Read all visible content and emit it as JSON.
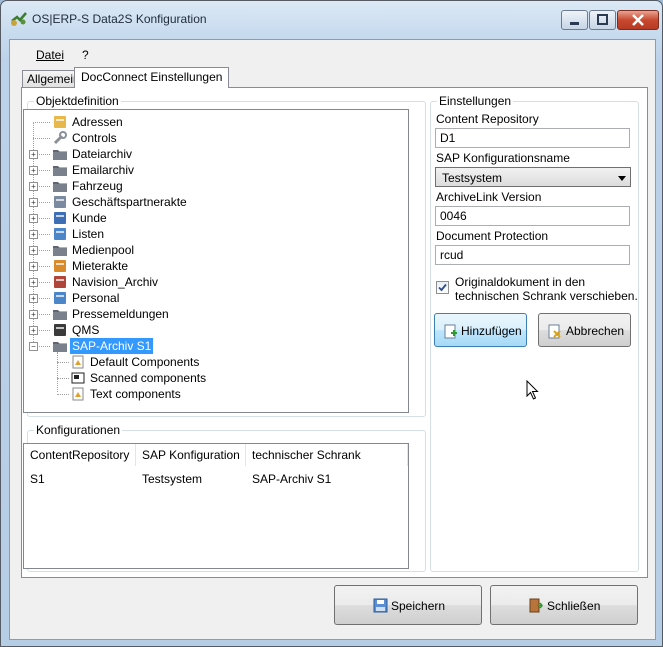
{
  "window": {
    "title": "OS|ERP-S Data2S Konfiguration"
  },
  "menu": {
    "datei": "Datei",
    "help": "?"
  },
  "tabs": [
    {
      "label": "Allgemein"
    },
    {
      "label": "DocConnect Einstellungen"
    }
  ],
  "objektdefinition": {
    "title": "Objektdefinition",
    "tree": [
      {
        "label": "Adressen",
        "icon": "address-book-icon",
        "expandable": false
      },
      {
        "label": "Controls",
        "icon": "wrench-icon",
        "expandable": false
      },
      {
        "label": "Dateiarchiv",
        "icon": "folder-icon",
        "expandable": true
      },
      {
        "label": "Emailarchiv",
        "icon": "folder-icon",
        "expandable": true
      },
      {
        "label": "Fahrzeug",
        "icon": "folder-icon",
        "expandable": true
      },
      {
        "label": "Geschäftspartnerakte",
        "icon": "document-pen-icon",
        "expandable": true
      },
      {
        "label": "Kunde",
        "icon": "customer-icon",
        "expandable": true
      },
      {
        "label": "Listen",
        "icon": "list-icon",
        "expandable": true
      },
      {
        "label": "Medienpool",
        "icon": "folder-icon",
        "expandable": true
      },
      {
        "label": "Mieterakte",
        "icon": "people-icon",
        "expandable": true
      },
      {
        "label": "Navision_Archiv",
        "icon": "archive-box-icon",
        "expandable": true
      },
      {
        "label": "Personal",
        "icon": "person-card-icon",
        "expandable": true
      },
      {
        "label": "Pressemeldungen",
        "icon": "folder-icon",
        "expandable": true
      },
      {
        "label": "QMS",
        "icon": "qms-icon",
        "expandable": true
      },
      {
        "label": "SAP-Archiv S1",
        "icon": "folder-icon",
        "expandable": true,
        "expanded": true,
        "selected": true
      }
    ],
    "children": [
      {
        "label": "Default Components",
        "icon": "component-icon"
      },
      {
        "label": "Scanned components",
        "icon": "scanner-icon"
      },
      {
        "label": "Text components",
        "icon": "component-icon"
      }
    ]
  },
  "einstellungen": {
    "title": "Einstellungen",
    "content_repository_label": "Content Repository",
    "content_repository_value": "D1",
    "sap_konfigurationsname_label": "SAP Konfigurationsname",
    "sap_konfigurationsname_value": "Testsystem",
    "archivelink_version_label": "ArchiveLink Version",
    "archivelink_version_value": "0046",
    "document_protection_label": "Document Protection",
    "document_protection_value": "rcud",
    "checkbox_line1": "Originaldokument in den",
    "checkbox_line2": "technischen Schrank verschieben.",
    "checkbox_checked": true,
    "add_button": "Hinzufügen",
    "cancel_button": "Abbrechen"
  },
  "konfigurationen": {
    "title": "Konfigurationen",
    "columns": [
      "ContentRepository",
      "SAP Konfiguration",
      "technischer Schrank"
    ],
    "rows": [
      [
        "S1",
        "Testsystem",
        "SAP-Archiv S1"
      ]
    ]
  },
  "footer": {
    "save_button": "Speichern",
    "close_button": "Schließen"
  },
  "colors": {
    "selection": "#3399ff",
    "window_frame": "#bcd2ea",
    "hover_button": "#bee6fd"
  }
}
